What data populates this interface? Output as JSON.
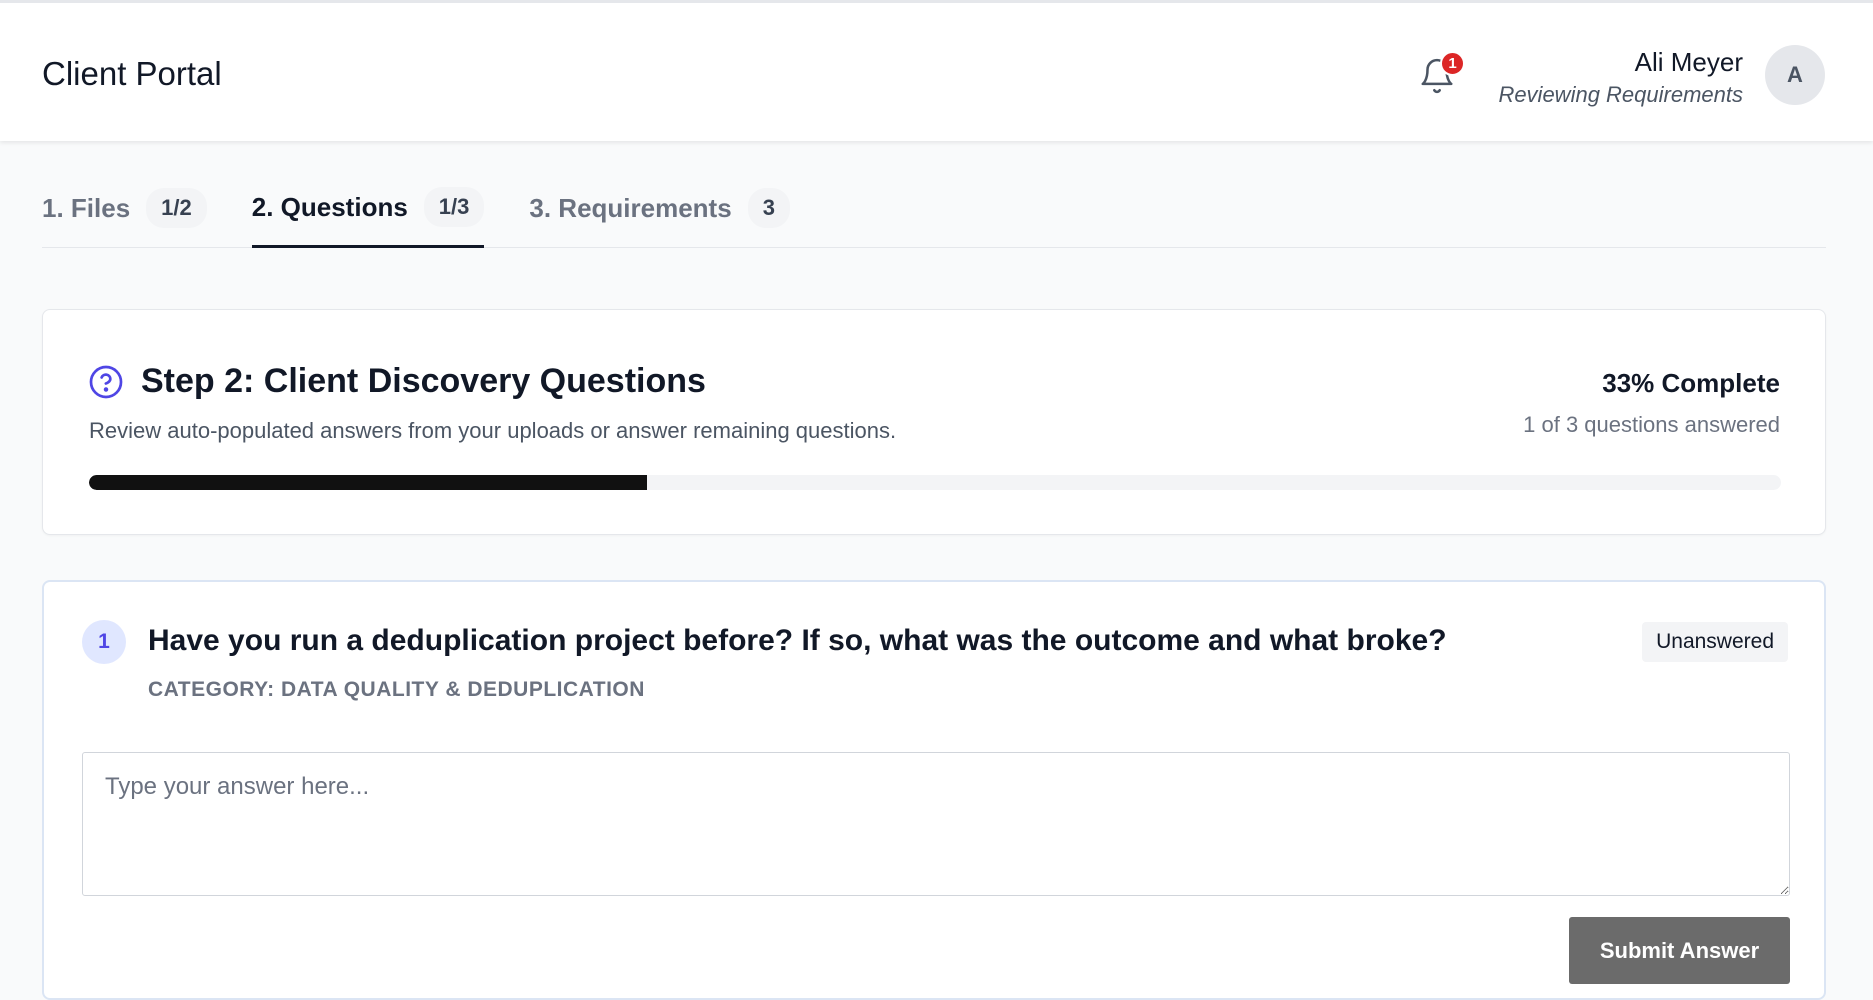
{
  "header": {
    "title": "Client Portal",
    "notifications_count": "1",
    "user_name": "Ali Meyer",
    "user_role": "Reviewing Requirements",
    "avatar_initial": "A"
  },
  "tabs": [
    {
      "label": "1. Files",
      "count": "1/2",
      "active": false
    },
    {
      "label": "2. Questions",
      "count": "1/3",
      "active": true
    },
    {
      "label": "3. Requirements",
      "count": "3",
      "active": false
    }
  ],
  "step": {
    "icon": "question-circle-icon",
    "title": "Step 2: Client Discovery Questions",
    "description": "Review auto-populated answers from your uploads or answer remaining questions.",
    "percent_label": "33% Complete",
    "answered_label": "1 of 3 questions answered",
    "progress_percent": 33
  },
  "question": {
    "number": "1",
    "text": "Have you run a deduplication project before? If so, what was the outcome and what broke?",
    "category": "CATEGORY: DATA QUALITY & DEDUPLICATION",
    "status": "Unanswered",
    "answer_value": "",
    "answer_placeholder": "Type your answer here...",
    "submit_label": "Submit Answer"
  },
  "colors": {
    "accent": "#4f46e5",
    "progress_fill": "#111111",
    "badge_red": "#dc2626",
    "submit_bg": "#6b6b6b"
  }
}
